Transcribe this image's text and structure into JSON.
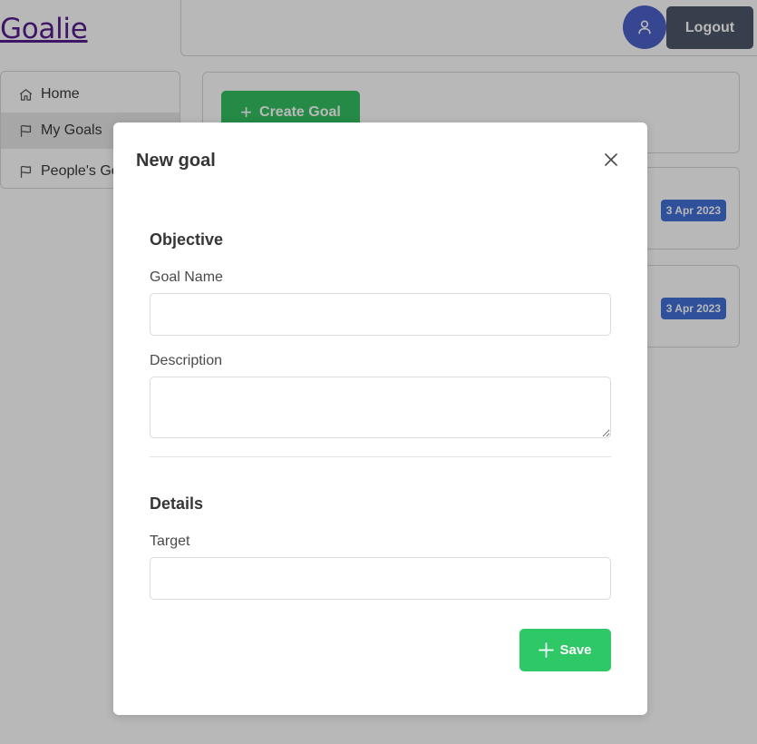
{
  "app": {
    "brand": "Goalie",
    "logout_label": "Logout"
  },
  "sidebar": {
    "items": [
      {
        "label": "Home",
        "icon": "home-icon"
      },
      {
        "label": "My Goals",
        "icon": "flag-icon"
      },
      {
        "label": "People's Goals",
        "icon": "flag-icon"
      }
    ]
  },
  "main": {
    "create_label": "Create Goal",
    "goals": [
      {
        "date": "3 Apr 2023"
      },
      {
        "date": "3 Apr 2023"
      }
    ]
  },
  "modal": {
    "title": "New goal",
    "objective_title": "Objective",
    "goal_name_label": "Goal Name",
    "goal_name_value": "",
    "description_label": "Description",
    "description_value": "",
    "details_title": "Details",
    "target_label": "Target",
    "target_value": "",
    "save_label": "Save"
  },
  "colors": {
    "brand_link": "#551a8b",
    "avatar": "#485fc7",
    "logout": "#4a5568",
    "success": "#2ec866",
    "date_tag": "#3e6ed8"
  }
}
